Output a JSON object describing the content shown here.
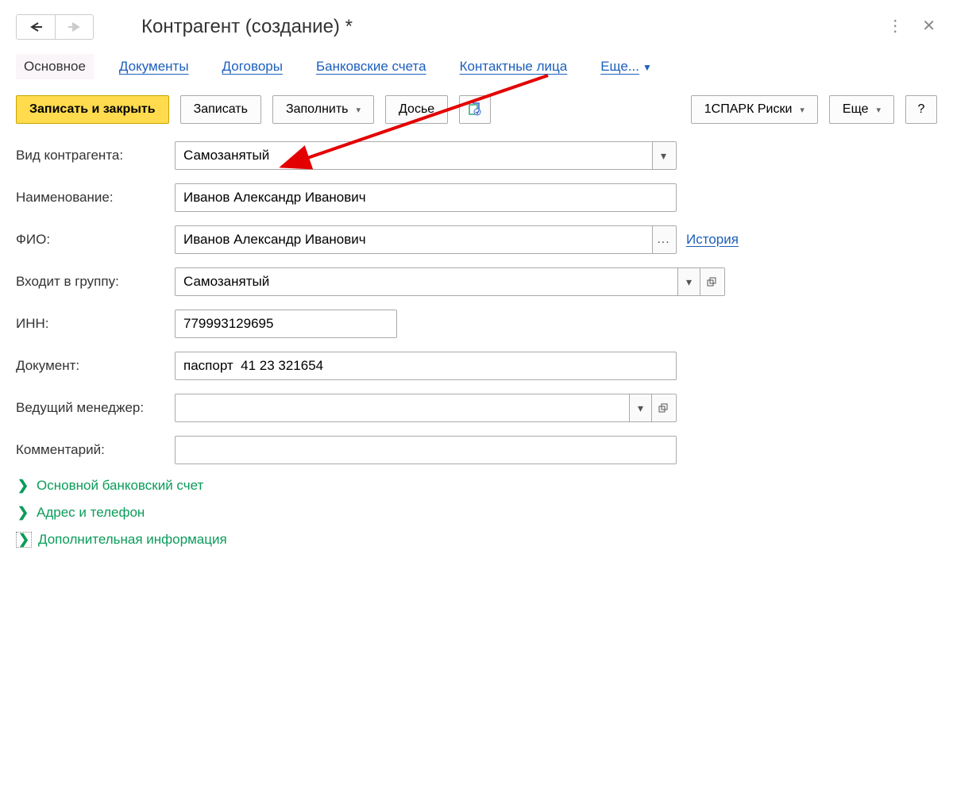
{
  "title": "Контрагент (создание) *",
  "tabs": {
    "main": "Основное",
    "documents": "Документы",
    "contracts": "Договоры",
    "bank_accounts": "Банковские счета",
    "contacts": "Контактные лица",
    "more": "Еще..."
  },
  "toolbar": {
    "save_close": "Записать и закрыть",
    "save": "Записать",
    "fill": "Заполнить",
    "dossier": "Досье",
    "spark": "1СПАРК Риски",
    "more": "Еще",
    "help": "?"
  },
  "labels": {
    "type": "Вид контрагента:",
    "name": "Наименование:",
    "fio": "ФИО:",
    "group": "Входит в группу:",
    "inn": "ИНН:",
    "doc": "Документ:",
    "manager": "Ведущий менеджер:",
    "comment": "Комментарий:",
    "history": "История"
  },
  "fields": {
    "type": "Самозанятый",
    "name": "Иванов Александр Иванович",
    "fio": "Иванов Александр Иванович",
    "group": "Самозанятый",
    "inn": "779993129695",
    "doc": "паспорт  41 23 321654",
    "manager": "",
    "comment": ""
  },
  "sections": {
    "bank": "Основной банковский счет",
    "address": "Адрес и телефон",
    "extra": "Дополнительная информация"
  }
}
